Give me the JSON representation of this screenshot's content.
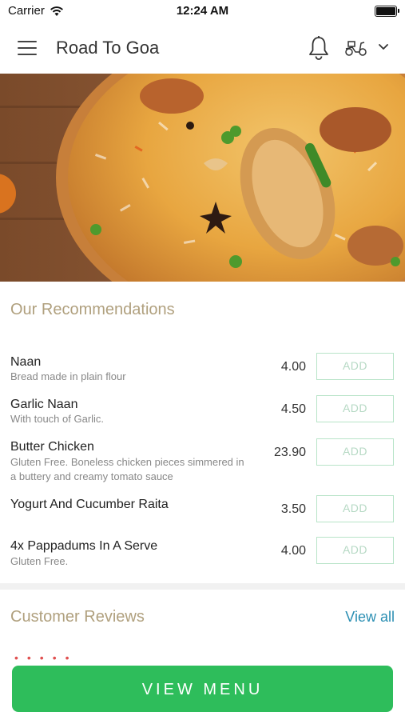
{
  "status_bar": {
    "carrier": "Carrier",
    "time": "12:24 AM"
  },
  "header": {
    "title": "Road To Goa",
    "icons": [
      "menu-icon",
      "bell-icon",
      "scooter-icon",
      "chevron-down-icon"
    ]
  },
  "recommendations": {
    "title": "Our Recommendations",
    "items": [
      {
        "name": "Naan",
        "description": "Bread made in plain flour",
        "price": "4.00",
        "add_label": "ADD"
      },
      {
        "name": "Garlic Naan",
        "description": "With touch of Garlic.",
        "price": "4.50",
        "add_label": "ADD"
      },
      {
        "name": "Butter Chicken",
        "description_line1": "Gluten Free. Boneless chicken pieces simmered in",
        "description_line2": "a buttery and creamy tomato sauce",
        "price": "23.90",
        "add_label": "ADD"
      },
      {
        "name": "Yogurt And Cucumber Raita",
        "description": "",
        "price": "3.50",
        "add_label": "ADD"
      },
      {
        "name": "4x Pappadums In A Serve",
        "description": "Gluten Free.",
        "price": "4.00",
        "add_label": "ADD"
      }
    ]
  },
  "reviews": {
    "title": "Customer Reviews",
    "view_all": "View all"
  },
  "footer": {
    "button_label": "VIEW MENU"
  },
  "colors": {
    "accent_green": "#2ebd5b",
    "section_title": "#b0a07e",
    "link_blue": "#2b8fb3"
  }
}
